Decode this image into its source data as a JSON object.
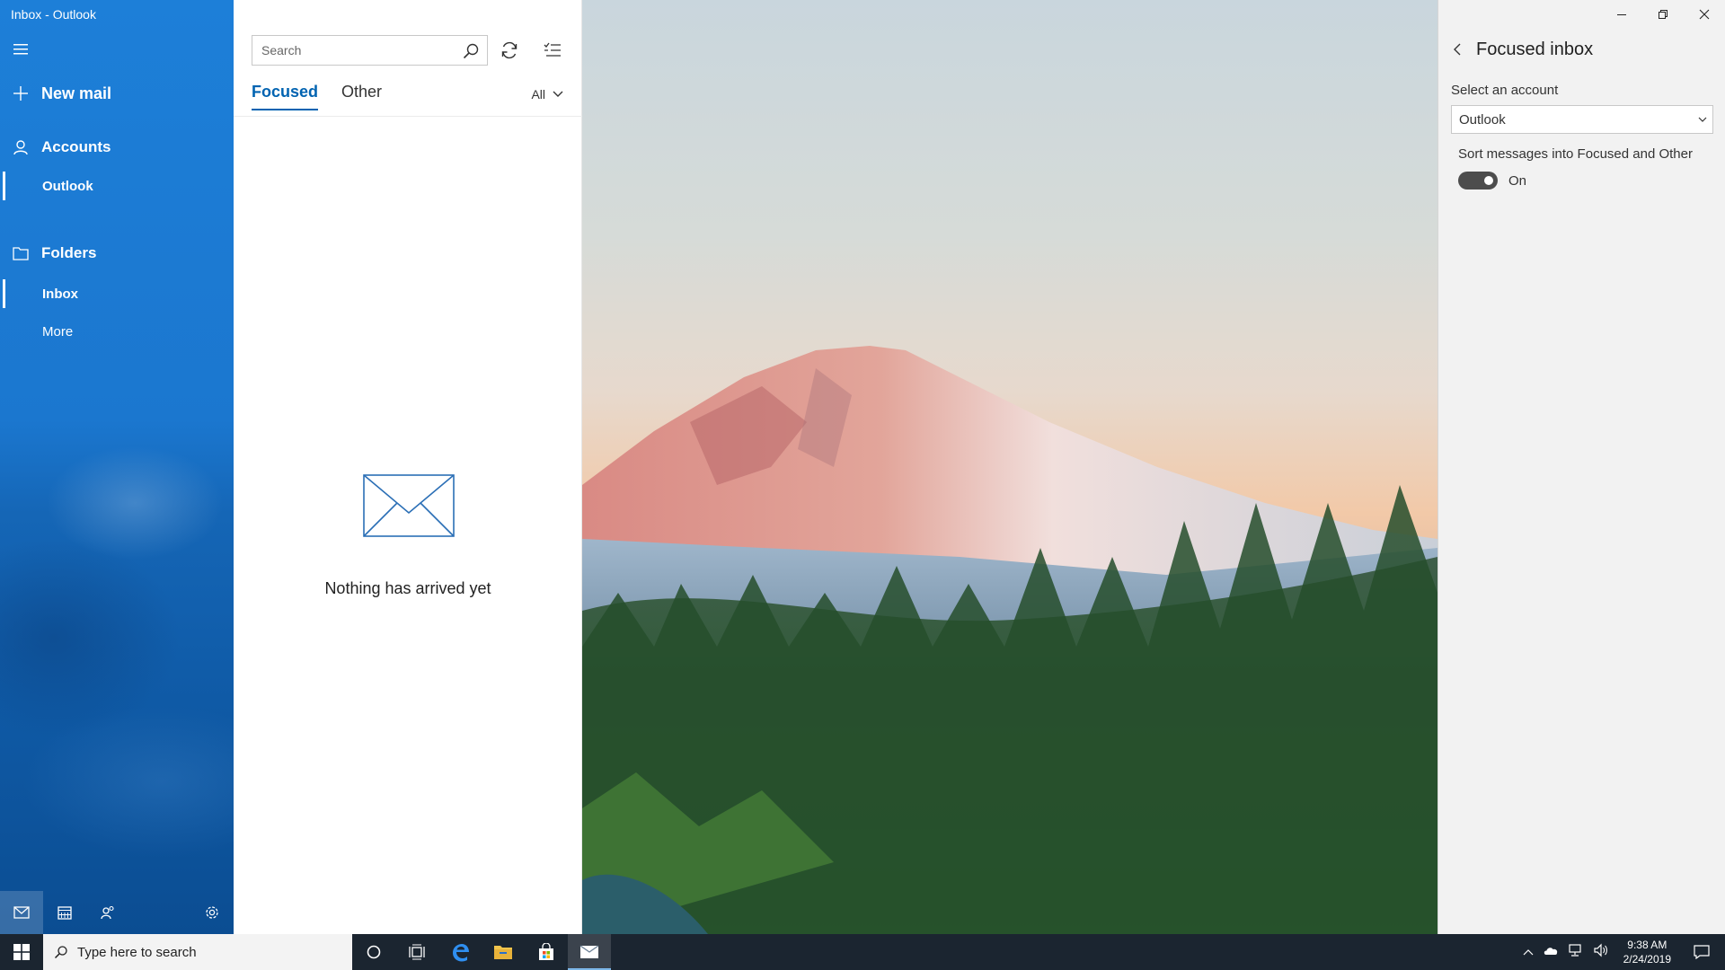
{
  "window": {
    "title": "Inbox - Outlook"
  },
  "nav": {
    "new_mail": "New mail",
    "accounts_heading": "Accounts",
    "account_name": "Outlook",
    "folders_heading": "Folders",
    "folders": [
      "Inbox",
      "More"
    ],
    "selected_folder": "Inbox"
  },
  "list": {
    "search_placeholder": "Search",
    "tabs": [
      "Focused",
      "Other"
    ],
    "active_tab": "Focused",
    "filter": "All",
    "empty_message": "Nothing has arrived yet"
  },
  "flyout": {
    "title": "Focused inbox",
    "select_account_label": "Select an account",
    "selected_account": "Outlook",
    "sort_label": "Sort messages into Focused and Other",
    "toggle_state": "On",
    "toggle_on": true
  },
  "taskbar": {
    "search_placeholder": "Type here to search",
    "time": "9:38 AM",
    "date": "2/24/2019"
  },
  "colors": {
    "accent": "#0063b1",
    "nav_background": "#1b77cf",
    "taskbar": "#1b2530"
  }
}
